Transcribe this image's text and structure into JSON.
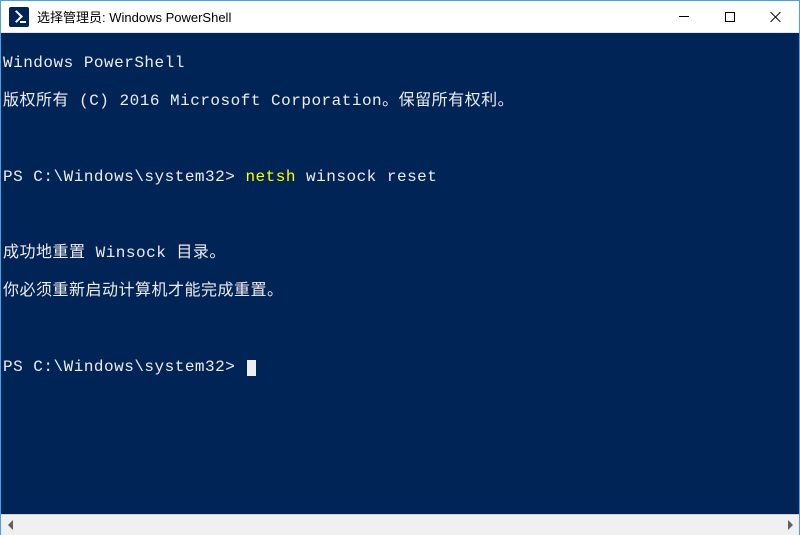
{
  "window": {
    "title": "选择管理员: Windows PowerShell"
  },
  "terminal": {
    "header_line1": "Windows PowerShell",
    "header_line2": "版权所有 (C) 2016 Microsoft Corporation。保留所有权利。",
    "prompt1_prefix": "PS C:\\Windows\\system32> ",
    "command1": "netsh",
    "command1_args": " winsock reset",
    "output_line1": "成功地重置 Winsock 目录。",
    "output_line2": "你必须重新启动计算机才能完成重置。",
    "prompt2": "PS C:\\Windows\\system32> "
  }
}
